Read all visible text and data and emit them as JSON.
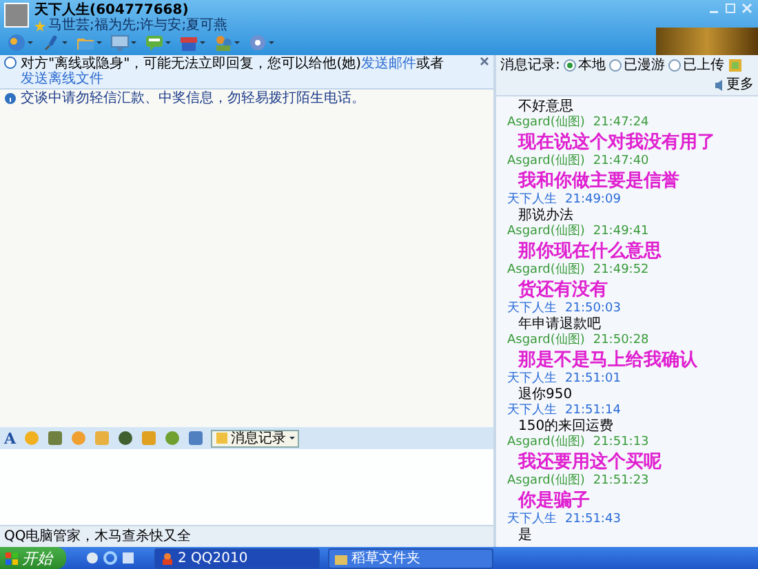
{
  "window": {
    "title": "天下人生(604777668)",
    "subtitle": "马世芸;福为先;许与安;夏可燕"
  },
  "chat": {
    "font_button": "A",
    "notice": {
      "before": "对方\"离线或隐身\"，可能无法立即回复，您可以给他(她)",
      "link1": "发送邮件",
      "middle": "或者",
      "link2": "发送离线文件"
    },
    "info": "交谈中请勿轻信汇款、中奖信息，勿轻易拨打陌生电话。",
    "history_button": "消息记录",
    "status": "QQ电脑管家，木马查杀快又全"
  },
  "history": {
    "label": "消息记录:",
    "options": [
      {
        "label": "本地",
        "selected": true
      },
      {
        "label": "已漫游",
        "selected": false
      },
      {
        "label": "已上传",
        "selected": false
      }
    ],
    "more": "更多",
    "entries": [
      {
        "kind": "plain",
        "text": "不好意思"
      },
      {
        "kind": "peer",
        "name": "Asgard(仙图)",
        "time": "21:47:24"
      },
      {
        "kind": "emph",
        "text": "现在说这个对我没有用了"
      },
      {
        "kind": "peer",
        "name": "Asgard(仙图)",
        "time": "21:47:40"
      },
      {
        "kind": "emph",
        "text": "我和你做主要是信誉"
      },
      {
        "kind": "own",
        "name": "天下人生",
        "time": "21:49:09"
      },
      {
        "kind": "plain",
        "text": "那说办法"
      },
      {
        "kind": "peer",
        "name": "Asgard(仙图)",
        "time": "21:49:41"
      },
      {
        "kind": "emph",
        "text": "那你现在什么意思"
      },
      {
        "kind": "peer",
        "name": "Asgard(仙图)",
        "time": "21:49:52"
      },
      {
        "kind": "emph",
        "text": "货还有没有"
      },
      {
        "kind": "own",
        "name": "天下人生",
        "time": "21:50:03"
      },
      {
        "kind": "plain",
        "text": "年申请退款吧"
      },
      {
        "kind": "peer",
        "name": "Asgard(仙图)",
        "time": "21:50:28"
      },
      {
        "kind": "emph",
        "text": "那是不是马上给我确认"
      },
      {
        "kind": "own",
        "name": "天下人生",
        "time": "21:51:01"
      },
      {
        "kind": "plain",
        "text": "退你950"
      },
      {
        "kind": "own",
        "name": "天下人生",
        "time": "21:51:14"
      },
      {
        "kind": "plain",
        "text": "150的来回运费"
      },
      {
        "kind": "peer",
        "name": "Asgard(仙图)",
        "time": "21:51:13"
      },
      {
        "kind": "emph",
        "text": "我还要用这个买呢"
      },
      {
        "kind": "peer",
        "name": "Asgard(仙图)",
        "time": "21:51:23"
      },
      {
        "kind": "emph",
        "text": "你是骗子"
      },
      {
        "kind": "own",
        "name": "天下人生",
        "time": "21:51:43"
      },
      {
        "kind": "plain",
        "text": "是"
      }
    ]
  },
  "taskbar": {
    "start": "开始",
    "tasks": [
      {
        "label": "2 QQ2010",
        "selected": true
      },
      {
        "label": "稻草文件夹",
        "selected": false
      }
    ]
  }
}
